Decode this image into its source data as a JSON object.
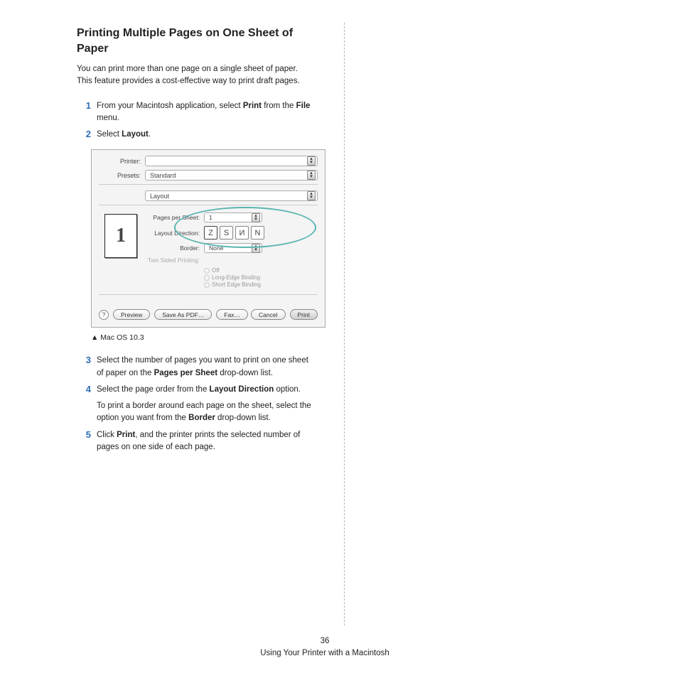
{
  "heading": "Printing Multiple Pages on One Sheet of Paper",
  "intro": "You can print more than one page on a single sheet of paper. This feature provides a cost-effective way to print draft pages.",
  "steps": {
    "s1": {
      "num": "1",
      "pre": "From your Macintosh application, select ",
      "b1": "Print",
      "mid": " from the ",
      "b2": "File",
      "post": " menu."
    },
    "s2": {
      "num": "2",
      "pre": "Select ",
      "b1": "Layout",
      "post": "."
    },
    "s3": {
      "num": "3",
      "pre": "Select the number of pages you want to print on one sheet of paper on the ",
      "b1": "Pages per Sheet",
      "post": " drop-down list."
    },
    "s4": {
      "num": "4",
      "pre": "Select the page order from the ",
      "b1": "Layout Direction",
      "post": " option.",
      "sub_pre": "To print a border around each page on the sheet, select the option you want from the ",
      "sub_b": "Border",
      "sub_post": " drop-down list."
    },
    "s5": {
      "num": "5",
      "pre": "Click ",
      "b1": "Print",
      "post": ", and the printer prints the selected number of pages on one side of each page."
    }
  },
  "dialog": {
    "printer_label": "Printer:",
    "printer_value": "",
    "presets_label": "Presets:",
    "presets_value": "Standard",
    "layout_value": "Layout",
    "preview_num": "1",
    "pps_label": "Pages per Sheet:",
    "pps_value": "1",
    "dir_label": "Layout Direction:",
    "border_label": "Border:",
    "border_value": "None",
    "twosided_label": "Two Sided Printing:",
    "r1": "Off",
    "r2": "Long-Edge Binding",
    "r3": "Short Edge Binding",
    "help": "?",
    "preview_btn": "Preview",
    "save_pdf": "Save As PDF…",
    "fax": "Fax…",
    "cancel": "Cancel",
    "print": "Print"
  },
  "caption": "▲ Mac OS 10.3",
  "footer_num": "36",
  "footer_text": "Using Your Printer with a Macintosh"
}
